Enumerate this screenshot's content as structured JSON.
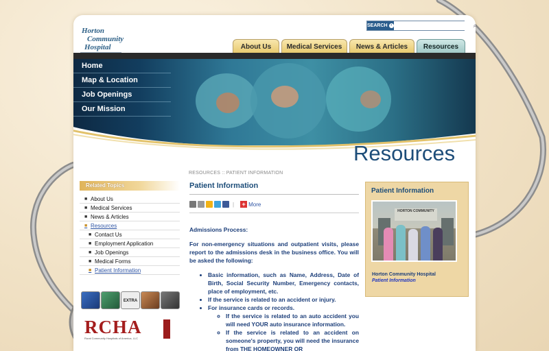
{
  "site": {
    "logo_text": [
      "Horton",
      "Community",
      "Hospital"
    ]
  },
  "search": {
    "button_label": "SEARCH",
    "placeholder": ""
  },
  "tabs": [
    {
      "label": "About Us"
    },
    {
      "label": "Medical Services"
    },
    {
      "label": "News & Articles"
    },
    {
      "label": "Resources",
      "active": true
    }
  ],
  "nav": [
    {
      "label": "Home"
    },
    {
      "label": "Map & Location"
    },
    {
      "label": "Job Openings"
    },
    {
      "label": "Our Mission"
    }
  ],
  "page_title": "Resources",
  "breadcrumb": "RESOURCES  ::  PATIENT INFORMATION",
  "related": {
    "heading": "Related Topics",
    "items": [
      {
        "label": "About Us"
      },
      {
        "label": "Medical Services"
      },
      {
        "label": "News & Articles"
      },
      {
        "label": "Resources"
      },
      {
        "label": "Contact Us"
      },
      {
        "label": "Employment Application"
      },
      {
        "label": "Job Openings"
      },
      {
        "label": "Medical Forms"
      },
      {
        "label": "Patient Information"
      }
    ]
  },
  "share": {
    "more_label": "More",
    "icon_names": [
      "email-icon",
      "print-icon",
      "favorite-icon",
      "twitter-icon",
      "facebook-icon"
    ]
  },
  "content": {
    "heading": "Patient Information",
    "section_title": "Admissions Process:",
    "intro": "For non-emergency situations and outpatient visits, please report to the admissions desk in the business office. You will be asked the following:",
    "bullets": [
      "Basic information, such as Name, Address, Date of Birth, Social Security Number, Emergency contacts, place of employment, etc.",
      "If the service is related to an accident or injury.",
      "For insurance cards or records."
    ],
    "sub_bullets": [
      "If the service is related to an auto accident you will need YOUR auto insurance information.",
      "If the service is related to an accident on someone's property, you will need the insurance from THE HOMEOWNER OR"
    ]
  },
  "sidebar_box": {
    "heading": "Patient Information",
    "photo_sign": "HORTON COMMUNITY",
    "caption_line1": "Horton Community Hospital",
    "caption_line2": "Patient Information"
  },
  "footer_logos": {
    "rcha": "RCHA",
    "rcha_sub": "Rural Community Hospitals of America, LLC",
    "extra_badge": "EXTRA",
    "icon_names": [
      "stethoscope-icon",
      "chart-icon",
      "extra-icon",
      "team-icon",
      "tools-icon"
    ]
  },
  "colors": {
    "brand_blue": "#1d4d79",
    "tab_gold": "#e7c86c",
    "tab_active": "#9fc7c5",
    "rcha_red": "#a41d1d"
  }
}
